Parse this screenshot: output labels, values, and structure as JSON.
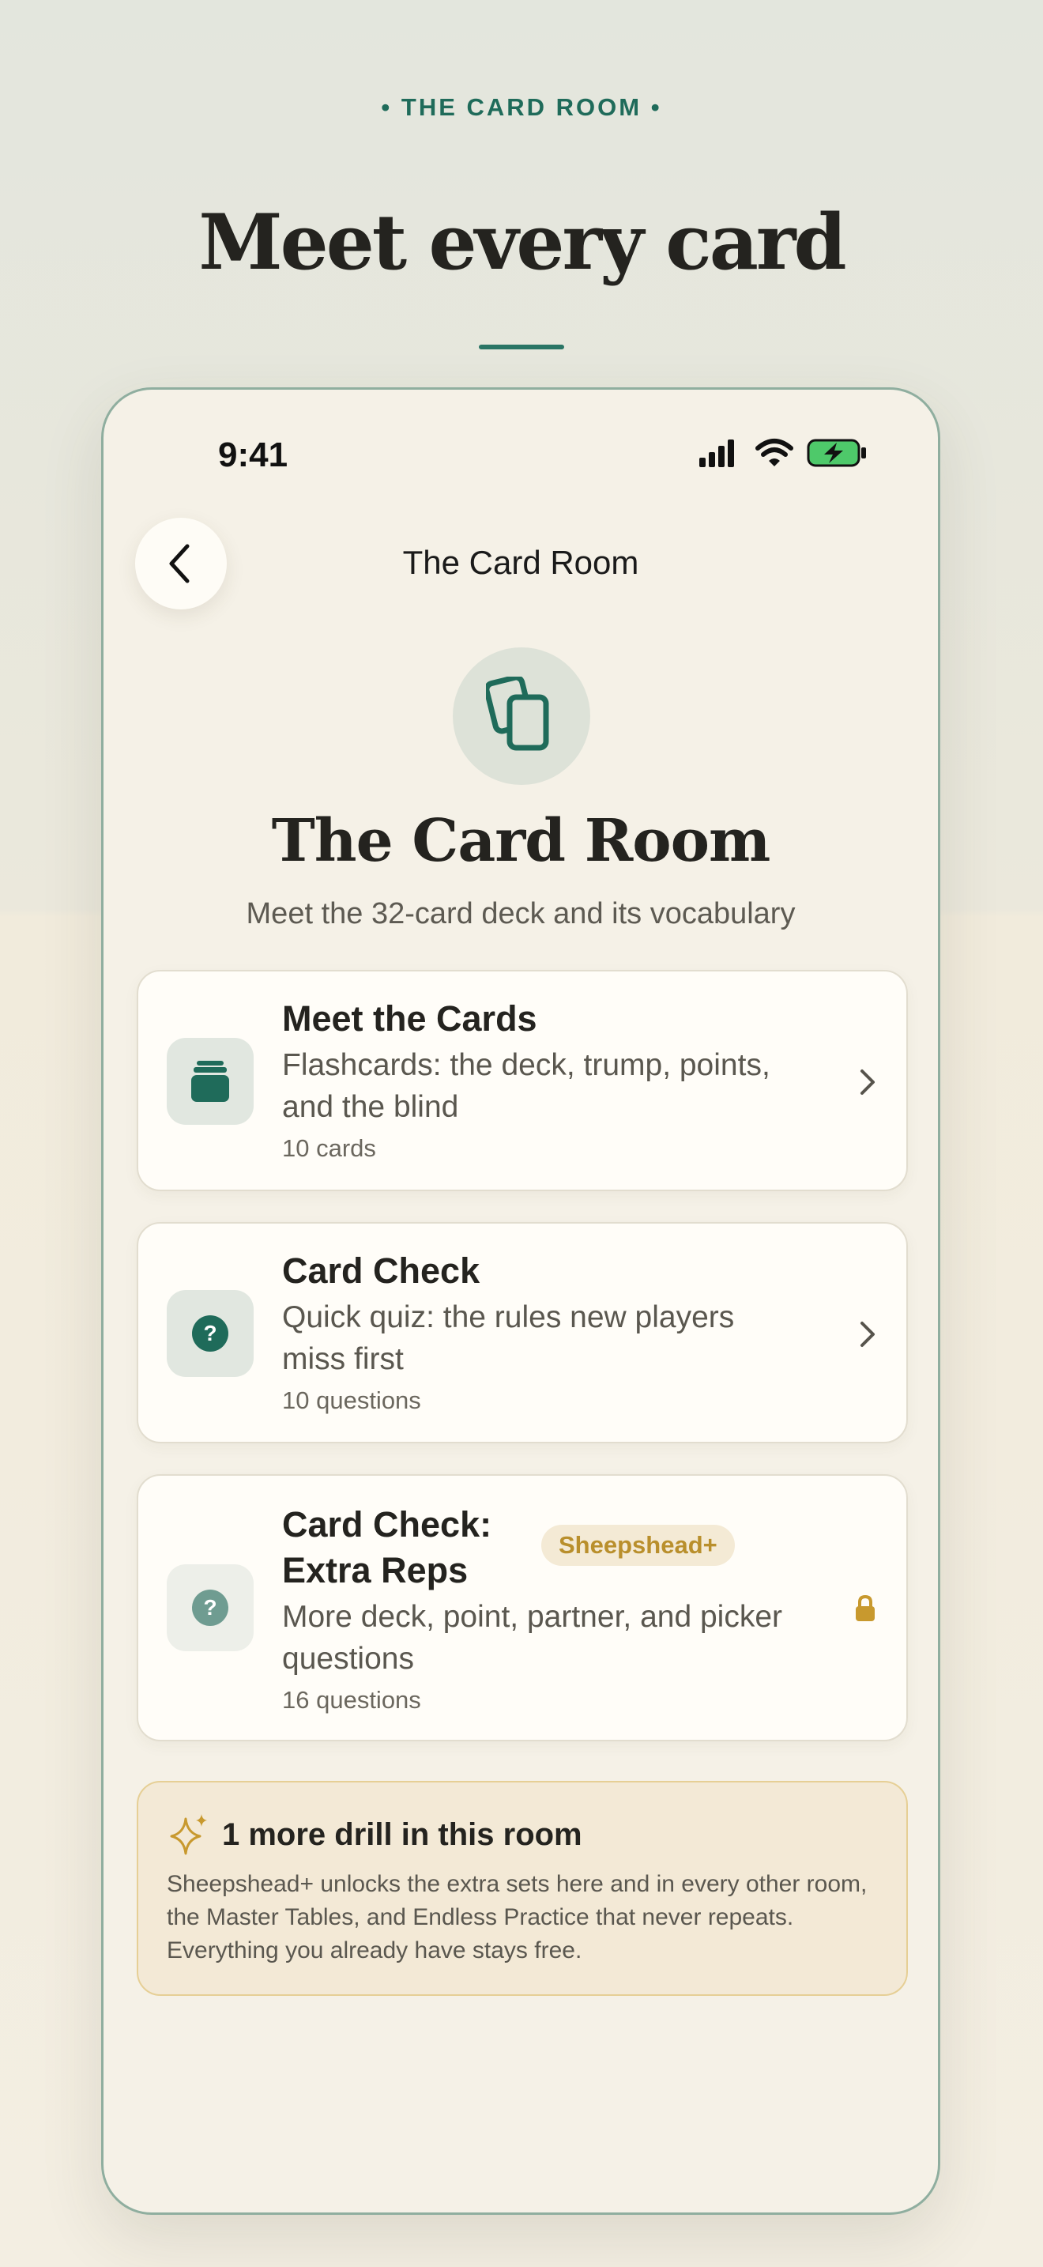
{
  "header": {
    "eyebrow": "• THE CARD ROOM •",
    "headline": "Meet every card"
  },
  "status_bar": {
    "time": "9:41",
    "icons": [
      "signal-icon",
      "wifi-icon",
      "battery-charging-icon"
    ]
  },
  "nav": {
    "back_icon": "chevron-left-icon",
    "title": "The Card Room"
  },
  "hero": {
    "icon": "cards-icon",
    "title": "The Card Room",
    "subtitle": "Meet the 32-card deck and its vocabulary"
  },
  "items": [
    {
      "title": "Meet the Cards",
      "description": "Flashcards: the deck, trump, points, and the blind",
      "meta": "10 cards",
      "icon": "card-stack-icon",
      "trailing": "chevron-right-icon"
    },
    {
      "title": "Card Check",
      "description": "Quick quiz: the rules new players miss first",
      "meta": "10 questions",
      "icon": "question-circle-icon",
      "trailing": "chevron-right-icon"
    },
    {
      "title_line1": "Card Check:",
      "title_line2": "Extra Reps",
      "badge": "Sheepshead+",
      "description": "More deck, point, partner, and picker questions",
      "meta": "16 questions",
      "icon": "question-circle-icon",
      "trailing": "lock-icon"
    }
  ],
  "promo": {
    "icon": "sparkle-icon",
    "title": "1 more drill in this room",
    "body": "Sheepshead+ unlocks the extra sets here and in every other room, the Master Tables, and Endless Practice that never repeats. Everything you already have stays free."
  },
  "colors": {
    "accent": "#1f6b5a",
    "gold": "#c8992e",
    "card_bg": "#fffdf8",
    "phone_bg": "#f5f1e7"
  }
}
